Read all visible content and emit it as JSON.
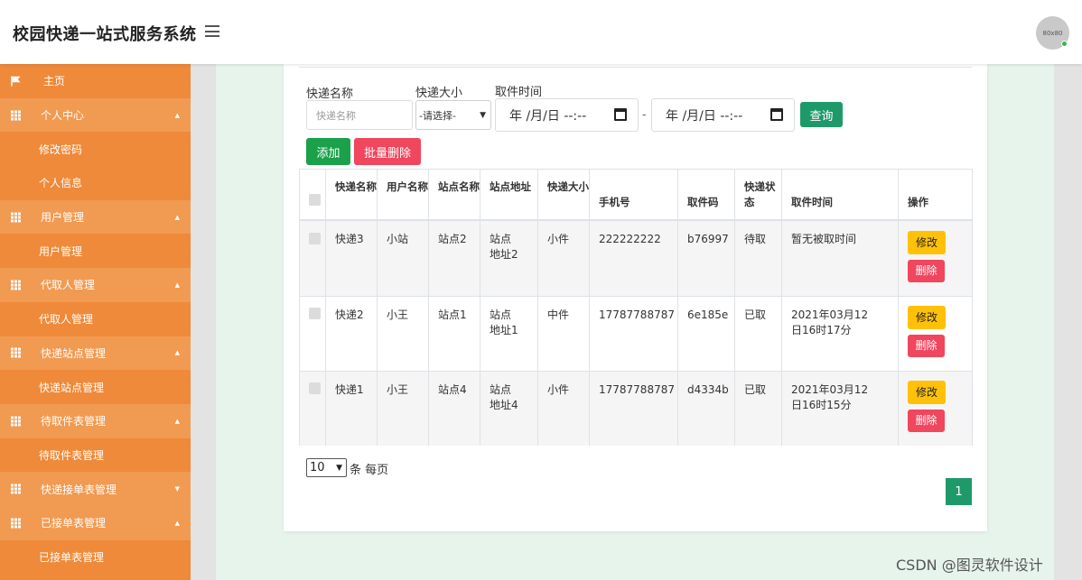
{
  "header": {
    "title": "校园快递一站式服务系统",
    "avatar_text": "80x80"
  },
  "sidebar": {
    "items": [
      {
        "label": "主页",
        "type": "home"
      },
      {
        "label": "个人中心",
        "type": "parent",
        "caret": "up"
      },
      {
        "label": "修改密码",
        "type": "sub"
      },
      {
        "label": "个人信息",
        "type": "sub"
      },
      {
        "label": "用户管理",
        "type": "parent",
        "caret": "up"
      },
      {
        "label": "用户管理",
        "type": "sub"
      },
      {
        "label": "代取人管理",
        "type": "parent",
        "caret": "up"
      },
      {
        "label": "代取人管理",
        "type": "sub"
      },
      {
        "label": "快递站点管理",
        "type": "parent",
        "caret": "up"
      },
      {
        "label": "快递站点管理",
        "type": "sub"
      },
      {
        "label": "待取件表管理",
        "type": "parent",
        "caret": "up"
      },
      {
        "label": "待取件表管理",
        "type": "sub"
      },
      {
        "label": "快递接单表管理",
        "type": "parent",
        "caret": "down"
      },
      {
        "label": "已接单表管理",
        "type": "parent",
        "caret": "up"
      },
      {
        "label": "已接单表管理",
        "type": "sub"
      }
    ]
  },
  "filters": {
    "name_label": "快递名称",
    "name_placeholder": "快递名称",
    "size_label": "快递大小",
    "size_value": "-请选择-",
    "time_label": "取件时间",
    "date_from": "年 /月/日 --:--",
    "date_to": "年 /月/日 --:--",
    "dash": "-",
    "query_button": "查询"
  },
  "actions": {
    "add_button": "添加",
    "batch_delete_button": "批量删除"
  },
  "table": {
    "headers": [
      "快递名称",
      "用户名称",
      "站点名称",
      "站点地址",
      "快递大小",
      "手机号",
      "取件码",
      "快递状态",
      "取件时间",
      "操作"
    ],
    "rows": [
      {
        "name": "快递3",
        "user": "小站",
        "station": "站点2",
        "address": "站点地址2",
        "size": "小件",
        "phone": "222222222",
        "code": "b76997",
        "status": "待取",
        "time": "暂无被取时间"
      },
      {
        "name": "快递2",
        "user": "小王",
        "station": "站点1",
        "address": "站点地址1",
        "size": "中件",
        "phone": "17787788787",
        "code": "6e185e",
        "status": "已取",
        "time": "2021年03月12日16时17分"
      },
      {
        "name": "快递1",
        "user": "小王",
        "station": "站点4",
        "address": "站点地址4",
        "size": "小件",
        "phone": "17787788787",
        "code": "d4334b",
        "status": "已取",
        "time": "2021年03月12日16时15分"
      }
    ],
    "edit_label": "修改",
    "delete_label": "删除"
  },
  "pagination": {
    "per_page_value": "10",
    "per_page_suffix": "条 每页",
    "current_page": "1"
  },
  "watermark": "CSDN @图灵软件设计",
  "colors": {
    "sidebar": "#ef8a3a",
    "primary_green": "#1e9a6a",
    "danger": "#f0465e",
    "warning": "#ffc107"
  }
}
